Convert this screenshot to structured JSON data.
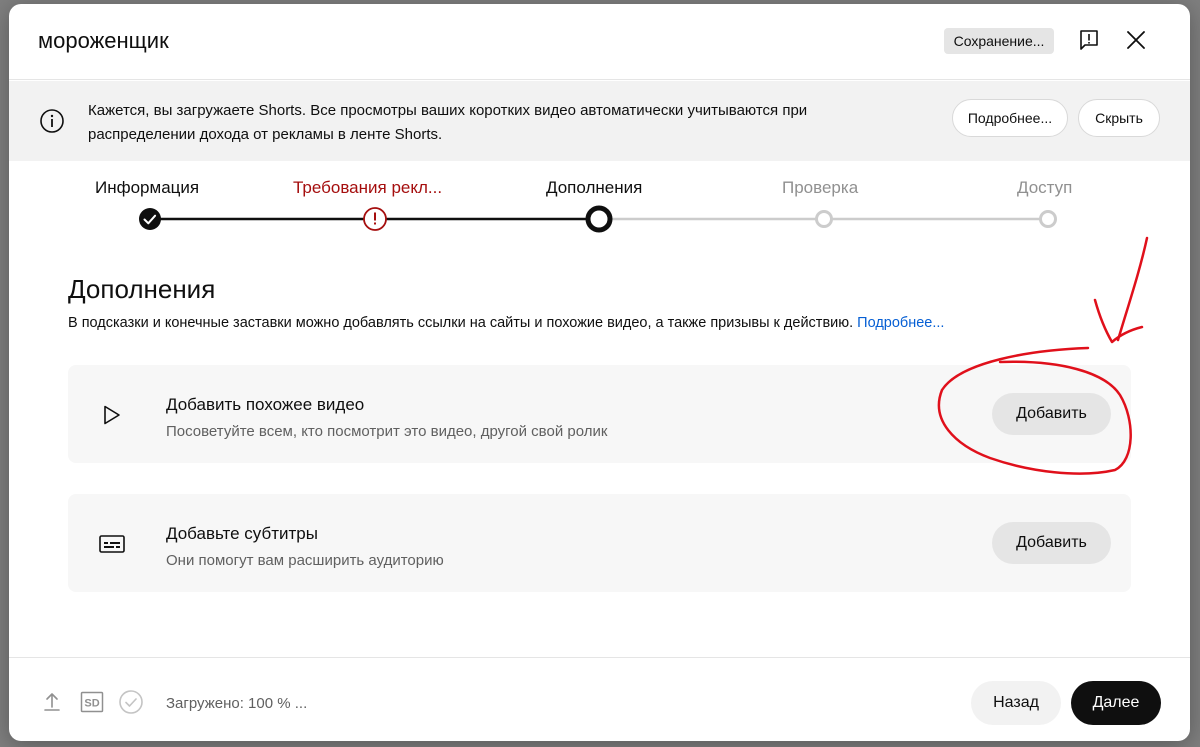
{
  "dialog": {
    "title": "мороженщик",
    "saving_status": "Сохранение...",
    "feedback_icon": "feedback-icon",
    "close_icon": "close-icon"
  },
  "banner": {
    "text": "Кажется, вы загружаете Shorts. Все просмотры ваших коротких видео автоматически учитываются при распределении дохода от рекламы в ленте Shorts.",
    "learn_more": "Подробнее...",
    "hide": "Скрыть"
  },
  "stepper": {
    "steps": [
      {
        "label": "Информация",
        "state": "done"
      },
      {
        "label": "Требования рекл...",
        "state": "error"
      },
      {
        "label": "Дополнения",
        "state": "current"
      },
      {
        "label": "Проверка",
        "state": "pending"
      },
      {
        "label": "Доступ",
        "state": "pending"
      }
    ]
  },
  "main": {
    "title": "Дополнения",
    "description": "В подсказки и конечные заставки можно добавлять ссылки на сайты и похожие видео, а также призывы к действию.",
    "learn_more": "Подробнее...",
    "cards": [
      {
        "icon": "play-icon",
        "title": "Добавить похожее видео",
        "subtitle": "Посоветуйте всем, кто посмотрит это видео, другой свой ролик",
        "button": "Добавить"
      },
      {
        "icon": "subtitles-icon",
        "title": "Добавьте субтитры",
        "subtitle": "Они помогут вам расширить аудиторию",
        "button": "Добавить"
      }
    ]
  },
  "footer": {
    "upload_status": "Загружено: 100 % ...",
    "sd_badge": "SD",
    "back": "Назад",
    "next": "Далее"
  },
  "colors": {
    "accent_link": "#065fd4",
    "error_red": "#a50e0e",
    "annotation_red": "#e0101b",
    "primary_button": "#0f0f0f"
  }
}
